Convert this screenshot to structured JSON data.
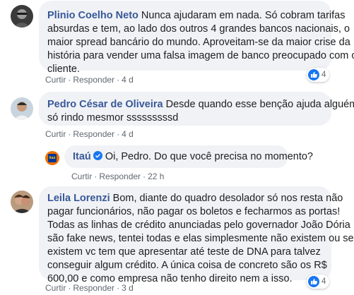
{
  "actions": {
    "like": "Curtir",
    "reply": "Responder",
    "sep": "·"
  },
  "comments": [
    {
      "author": "Plinio Coelho Neto",
      "lines": [
        "Nunca ajudaram em nada. Só cobram tarifas",
        "absurdas e tem, ao lado dos outros 4 grandes bancos nacionais, o",
        "maior spread bancário do mundo. Aproveitam-se da maior crise da",
        "história para vender uma falsa imagem de banco preocupado com o",
        "cliente."
      ],
      "time": "4 d",
      "reactions": "4"
    },
    {
      "author": "Pedro César de Oliveira",
      "lines": [
        "Desde quando esse benção ajuda alguém",
        "só rindo mesmor sssssssssd"
      ],
      "time": "4 d"
    },
    {
      "author": "Itaú",
      "lines": [
        "Oi, Pedro. Do que você precisa no momento?"
      ],
      "time": "22 h",
      "avatar_text": "Itaú",
      "verified": true
    },
    {
      "author": "Leila Lorenzi",
      "lines": [
        "Bom, diante do quadro desolador só nos resta não",
        "pagar funcionários, não pagar os boletos e fecharmos as portas!",
        "Todas as linhas de crédito anunciadas pelo governador João Dória",
        "são fake news, tentei todas e elas simplesmente não existem ou se",
        "existem vc tem que apresentar até teste de DNA para talvez",
        "conseguir algum crédito. A única coisa de concreto são os R$",
        "600,00 e como empresa não tenho direito nem a isso."
      ],
      "time": "3 d",
      "reactions": "4"
    }
  ],
  "colors": {
    "author": "#385898",
    "bubble": "#f0f2f5",
    "like": "#1877f2",
    "itau_orange": "#ec7000",
    "itau_blue": "#003399"
  }
}
